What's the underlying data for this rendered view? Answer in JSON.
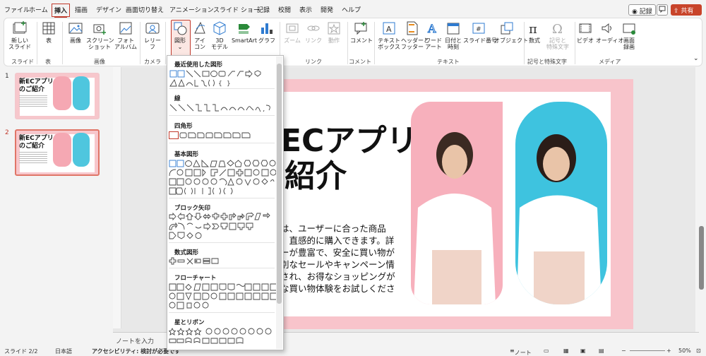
{
  "menu": {
    "tabs": [
      "ファイル",
      "ホーム",
      "挿入",
      "描画",
      "デザイン",
      "画面切り替え",
      "アニメーション",
      "スライド ショー",
      "記録",
      "校閲",
      "表示",
      "開発",
      "ヘルプ"
    ],
    "active_tab": "挿入",
    "record_label": "◉ 記録",
    "comment_icon": "comment-icon",
    "share_label": "共有"
  },
  "ribbon": {
    "buttons": {
      "new_slide": "新しい\nスライド",
      "table": "表",
      "images": "画像",
      "screenshot": "スクリーン\nショット",
      "photo_album": "フォト\nアルバム",
      "cameo": "レリー\nフ",
      "shapes": "図形",
      "icons": "アイ\nコン",
      "model3d": "3D\nモデル",
      "smartart": "SmartArt",
      "chart": "グラフ",
      "zoom": "ズーム",
      "link": "リンク",
      "action": "動作",
      "comment": "コメント",
      "textbox": "テキスト\nボックス",
      "header_footer": "ヘッダーと\nフッター",
      "wordart": "ワード\nアート",
      "datetime": "日付と\n時刻",
      "slide_number": "スライド番号",
      "object": "オブジェクト",
      "equation": "数式",
      "symbol": "記号と\n特殊文字",
      "video": "ビデオ",
      "audio": "オーディオ",
      "screen_recording": "画面\n録画"
    },
    "groups": {
      "slides": "スライド",
      "tables": "表",
      "images": "画像",
      "camera": "カメラ",
      "links": "リンク",
      "comments": "コメント",
      "text": "テキスト",
      "symbols": "記号と特殊文字",
      "media": "メディア"
    }
  },
  "thumbnails": [
    {
      "number": "1",
      "title_line1": "新ECアプリ",
      "title_line2": "のご紹介"
    },
    {
      "number": "2",
      "title_line1": "新ECアプリ",
      "title_line2": "のご紹介"
    }
  ],
  "slide": {
    "title_line1": "ECアプリ",
    "title_line2": "紹介",
    "body_lines": [
      "は、ユーザーに合った商品",
      "　直感的に購入できます。詳",
      "ーが豊富で、安全に買い物が",
      "別なセールやキャンペーン情",
      "され、お得なショッピングが",
      "な買い物体験をお試しくださ"
    ]
  },
  "notes_placeholder": "ノートを入力",
  "status_bar": {
    "slide_info": "スライド 2/2",
    "language": "日本語",
    "accessibility": "アクセシビリティ: 検討が必要です",
    "notes_label": "ノート",
    "zoom": "50%"
  },
  "shapes_menu": {
    "sections": [
      "最近使用した図形",
      "線",
      "四角形",
      "基本図形",
      "ブロック矢印",
      "数式図形",
      "フローチャート",
      "星とリボン"
    ]
  },
  "colors": {
    "accent": "#c0392b",
    "slide_pink": "#f8c4cb",
    "photo_pink": "#f7b0bc",
    "photo_blue": "#3ec3df",
    "share_button": "#c8442a"
  }
}
